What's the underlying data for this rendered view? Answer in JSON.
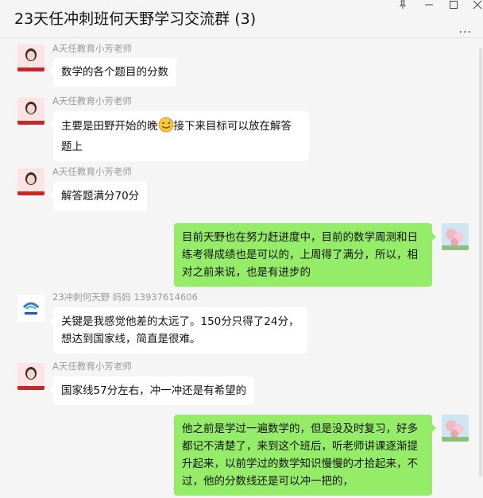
{
  "window": {
    "title": "23天任冲刺班何天野学习交流群 (3)",
    "pin_icon": "pin-icon",
    "more_dots": "···"
  },
  "messages": [
    {
      "side": "left",
      "sender": "A天任教育小芳老师",
      "text": "数学的各个题目的分数"
    },
    {
      "side": "left",
      "sender": "A天任教育小芳老师",
      "text_before": "主要是田野开始的晚",
      "emoji": "sweat-smile-emoji",
      "text_after": "接下来目标可以放在解答题上"
    },
    {
      "side": "left",
      "sender": "A天任教育小芳老师",
      "text": "解答题满分70分"
    },
    {
      "side": "right",
      "text": "目前天野也在努力赶进度中，目前的数学周测和日练考得成绩也是可以的，上周得了满分，所以，相对之前来说，也是有进步的"
    },
    {
      "side": "left",
      "sender": "23冲刺何天野 妈妈  13937614606",
      "text": "关键是我感觉他差的太远了。150分只得了24分，想达到国家线，简直是很难。"
    },
    {
      "side": "left",
      "sender": "A天任教育小芳老师",
      "text": "国家线57分左右，冲一冲还是有希望的"
    },
    {
      "side": "right",
      "text": "他之前是学过一遍数学的，但是没及时复习，好多都记不清楚了，来到这个班后，听老师讲课逐渐提升起来，以前学过的数学知识慢慢的才拾起来，不过，他的分数线还是可以冲一把的，"
    }
  ],
  "colors": {
    "self_bubble": "#95ec69",
    "other_bubble": "#ffffff",
    "background": "#f5f5f5"
  }
}
